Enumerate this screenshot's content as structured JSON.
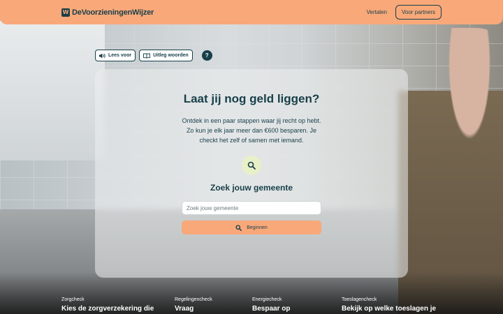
{
  "header": {
    "logo_mark": "W",
    "logo_text": "DeVoorzieningenWijzer",
    "translate_link": "Vertalen",
    "partners_button": "Voor partners"
  },
  "toolbar": {
    "read_aloud": "Lees voor",
    "explain_words": "Uitleg woorden",
    "help": "?"
  },
  "card": {
    "title": "Laat jij nog geld liggen?",
    "description": "Ontdek in een paar stappen waar jij recht op hebt. Zo kun je elk jaar meer dan €600 besparen. Je checkt het zelf of samen met iemand.",
    "subtitle": "Zoek jouw gemeente",
    "search_placeholder": "Zoek jouw gemeente",
    "start_button": "Beginnen"
  },
  "tiles": [
    {
      "kicker": "Zorgcheck",
      "heading": "Kies de zorgverzekering die"
    },
    {
      "kicker": "Regelingencheck",
      "heading": "Vraag"
    },
    {
      "kicker": "Energiecheck",
      "heading": "Bespaar op"
    },
    {
      "kicker": "Toeslagencheck",
      "heading": "Bekijk op welke toeslagen je"
    }
  ],
  "colors": {
    "brand_orange": "#f9a879",
    "brand_dark": "#173f4a",
    "search_circle": "#e8f0c8"
  },
  "icons": [
    "speaker-icon",
    "book-icon",
    "help-icon",
    "search-icon"
  ]
}
